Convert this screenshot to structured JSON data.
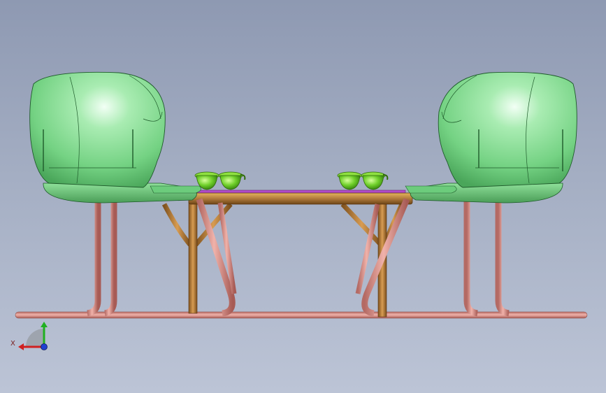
{
  "viewport": {
    "background_top": "#8e99b2",
    "background_bottom": "#bcc4d6"
  },
  "colors": {
    "seat_shell": "#8fe09a",
    "seat_shell_dark": "#4fae5e",
    "seat_highlight": "#eafff0",
    "tube": "#d98c86",
    "tube_dark": "#a85a55",
    "table_frame": "#b07a3c",
    "table_top_edge": "#c9922f",
    "table_top_accent": "#b04ac8",
    "cups": "#6fcf2a",
    "cups_dark": "#3c8a12"
  },
  "triad": {
    "x_label": "X",
    "x_color": "#d02020",
    "y_color": "#20b020",
    "z_color": "#2040d0",
    "icon": "coordinate-triad-icon"
  }
}
